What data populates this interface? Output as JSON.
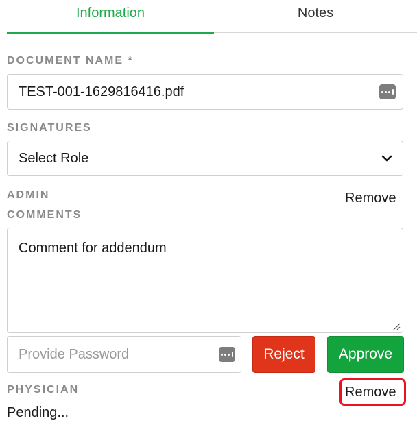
{
  "tabs": [
    {
      "label": "Information",
      "active": true
    },
    {
      "label": "Notes",
      "active": false
    }
  ],
  "document": {
    "label": "DOCUMENT NAME",
    "required_mark": "*",
    "value": "TEST-001-1629816416.pdf",
    "icon": "more-dots-icon"
  },
  "signatures": {
    "label": "SIGNATURES",
    "selected": "Select Role",
    "icon": "chevron-down-icon"
  },
  "admin": {
    "label_line1": "ADMIN",
    "label_line2": "COMMENTS",
    "remove_label": "Remove",
    "comment": "Comment for addendum",
    "password_placeholder": "Provide Password",
    "reject_label": "Reject",
    "approve_label": "Approve"
  },
  "physician": {
    "label": "PHYSICIAN",
    "remove_label": "Remove",
    "status": "Pending..."
  },
  "colors": {
    "accent_green": "#1ea94a",
    "reject_red": "#e0341b",
    "approve_green": "#13a43e",
    "highlight_red": "#e8141f",
    "label_gray": "#8a8a8a"
  }
}
